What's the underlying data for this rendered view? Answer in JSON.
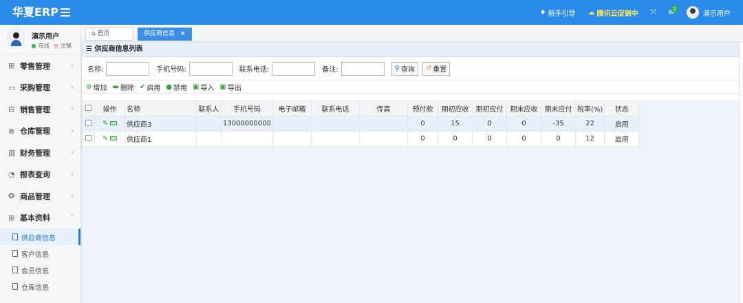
{
  "brand": "华夏ERP",
  "top": {
    "guide": "新手引导",
    "promo": "腾讯云促销中",
    "badge": "1",
    "user": "演示用户"
  },
  "user": {
    "name": "演示用户",
    "online": "在线",
    "logout": "注销"
  },
  "menu": [
    {
      "icon": "⊞",
      "label": "零售管理",
      "chev": "‹"
    },
    {
      "icon": "▭",
      "label": "采购管理",
      "chev": "‹"
    },
    {
      "icon": "⊟",
      "label": "销售管理",
      "chev": "‹"
    },
    {
      "icon": "⊗",
      "label": "仓库管理",
      "chev": "‹"
    },
    {
      "icon": "▥",
      "label": "财务管理",
      "chev": "‹"
    },
    {
      "icon": "◔",
      "label": "报表查询",
      "chev": "‹"
    },
    {
      "icon": "❂",
      "label": "商品管理",
      "chev": "‹"
    },
    {
      "icon": "⊞",
      "label": "基本资料",
      "chev": "˅"
    }
  ],
  "submenu": [
    "供应商信息",
    "客户信息",
    "会员信息",
    "仓库信息"
  ],
  "tabs": {
    "home": "首页",
    "current": "供应商信息",
    "close": "×"
  },
  "panel": {
    "title": "供应商信息列表"
  },
  "search": {
    "name": "名称:",
    "phone": "手机号码:",
    "tel": "联系电话:",
    "remark": "备注:",
    "query": "查询",
    "reset": "重置"
  },
  "toolbar": [
    "增加",
    "删除",
    "启用",
    "禁用",
    "导入",
    "导出"
  ],
  "columns": [
    "操作",
    "名称",
    "联系人",
    "手机号码",
    "电子邮箱",
    "联系电话",
    "传真",
    "预付款",
    "期初应收",
    "期初应付",
    "期末应收",
    "期末应付",
    "税率(%)",
    "状态"
  ],
  "rows": [
    {
      "name": "供应商3",
      "contact": "",
      "mobile": "13000000000",
      "email": "",
      "tel": "",
      "fax": "",
      "prepay": "0",
      "begin_recv": "15",
      "begin_pay": "0",
      "end_recv": "0",
      "end_pay": "-35",
      "tax": "22",
      "status": "启用"
    },
    {
      "name": "供应商1",
      "contact": "",
      "mobile": "",
      "email": "",
      "tel": "",
      "fax": "",
      "prepay": "0",
      "begin_recv": "0",
      "begin_pay": "0",
      "end_recv": "0",
      "end_pay": "0",
      "tax": "12",
      "status": "启用"
    }
  ],
  "colors": {
    "topbar": "#2a8ce8",
    "active": "#2a78d0",
    "green": "#3aa13a"
  }
}
